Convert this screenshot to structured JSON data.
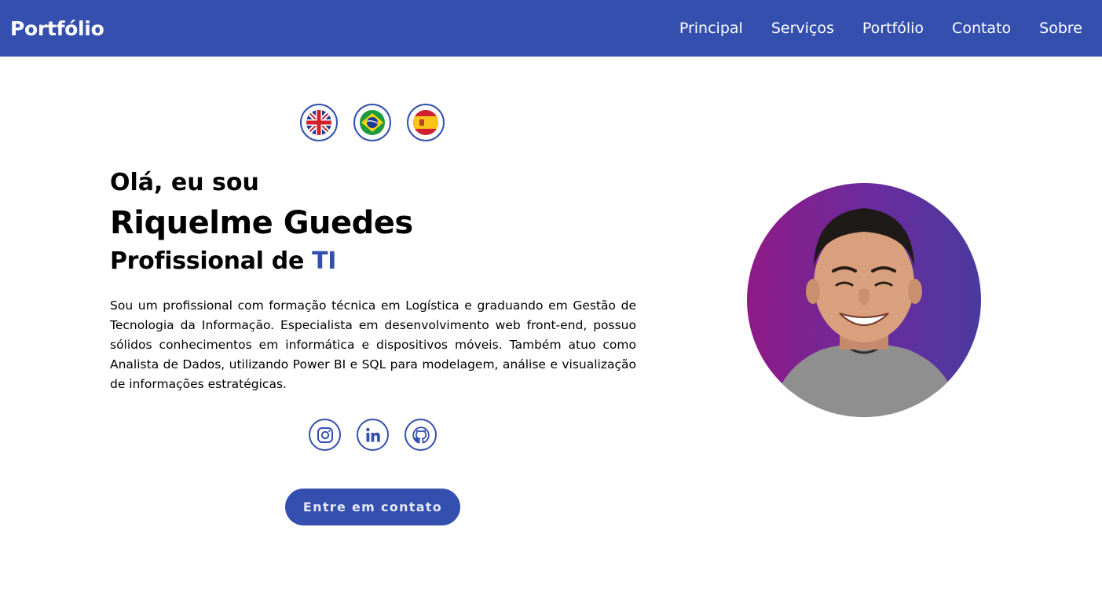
{
  "header": {
    "brand": "Portfólio",
    "nav": [
      "Principal",
      "Serviços",
      "Portfólio",
      "Contato",
      "Sobre"
    ]
  },
  "languages": [
    {
      "icon": "uk-flag-icon"
    },
    {
      "icon": "brazil-flag-icon"
    },
    {
      "icon": "spain-flag-icon"
    }
  ],
  "hero": {
    "greeting": "Olá, eu sou",
    "name": "Riquelme Guedes",
    "role_prefix": "Profissional de ",
    "role_accent": "TI",
    "bio": "Sou um profissional com formação técnica em Logística e graduando em Gestão de Tecnologia da Informação. Especialista em desenvolvimento web front-end, possuo sólidos conhecimentos em informática e dispositivos móveis. Também atuo como Analista de Dados, utilizando Power BI e SQL para modelagem, análise e visualização de informações estratégicas.",
    "cta_label": "Entre em contato"
  },
  "socials": [
    {
      "icon": "instagram-icon"
    },
    {
      "icon": "linkedin-icon"
    },
    {
      "icon": "github-icon"
    }
  ],
  "colors": {
    "accent": "#344fae",
    "background": "#ffffff",
    "avatar_gradient_start": "#8e1a86",
    "avatar_gradient_end": "#4a3a9e"
  }
}
